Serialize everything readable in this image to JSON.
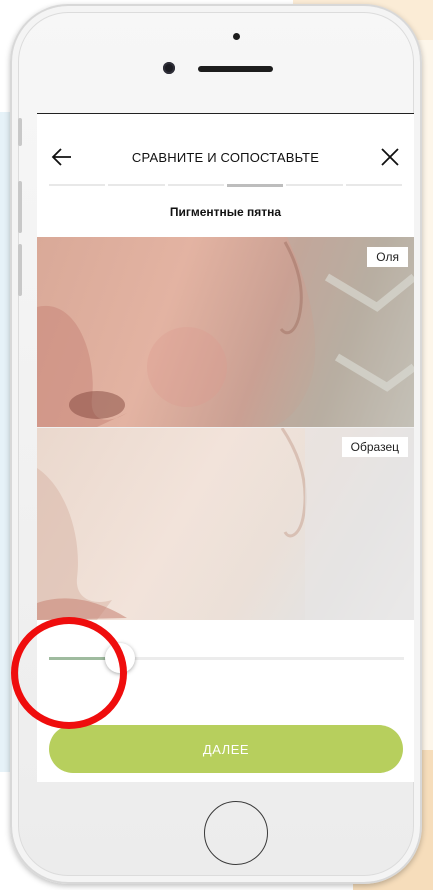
{
  "header": {
    "title": "СРАВНИТЕ И СОПОСТАВЬТЕ",
    "back_icon": "arrow-left-icon",
    "close_icon": "close-icon"
  },
  "progress": {
    "total_steps": 6,
    "current_step": 4
  },
  "subtitle": "Пигментные пятна",
  "photos": {
    "top_label": "Оля",
    "bottom_label": "Образец"
  },
  "slider": {
    "value": 0.2
  },
  "buttons": {
    "next_label": "ДАЛЕЕ"
  },
  "colors": {
    "accent": "#b7cf5d",
    "highlight": "#ef0d0d",
    "slider_fill": "#9fbb9f"
  }
}
